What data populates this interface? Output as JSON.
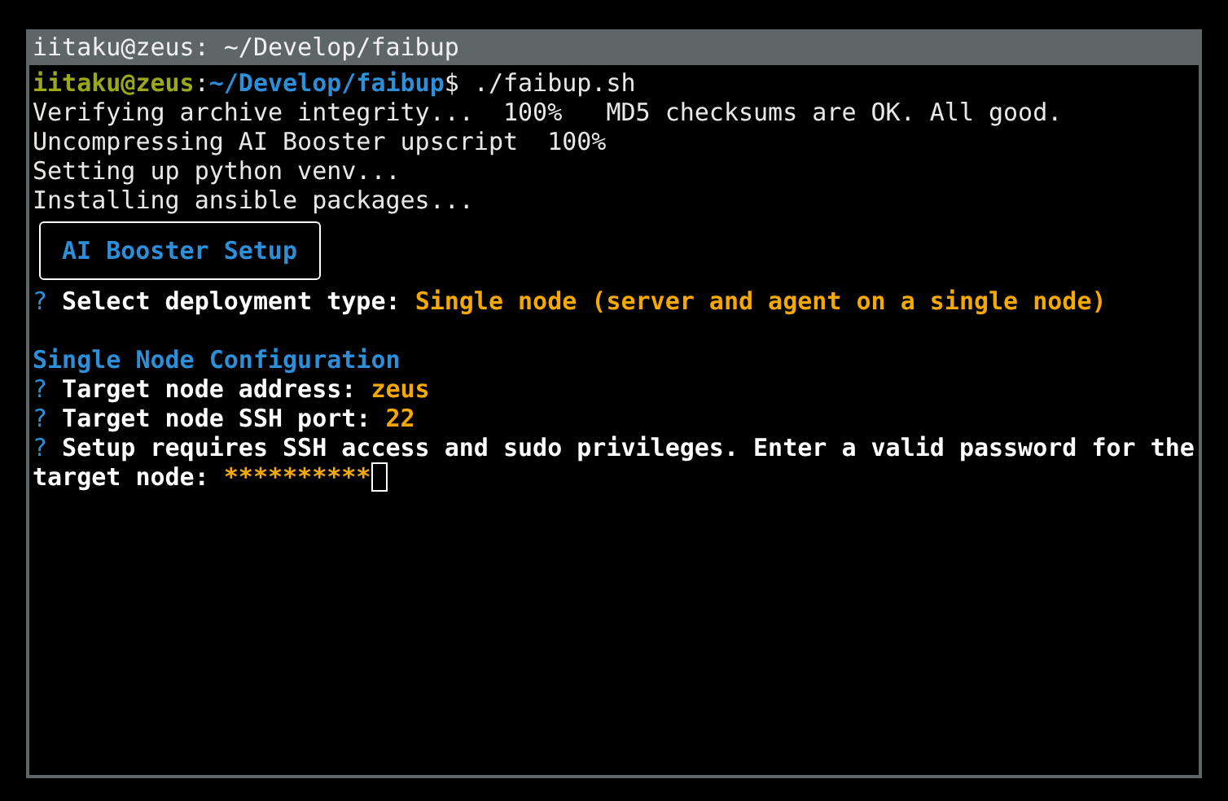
{
  "window": {
    "title": "iitaku@zeus: ~/Develop/faibup"
  },
  "terminal": {
    "lines": [
      {
        "kind": "text",
        "segments": [
          {
            "text": "iitaku@zeus",
            "kind": "user"
          },
          {
            "text": ":",
            "kind": "plain"
          },
          {
            "text": "~/Develop/faibup",
            "kind": "path"
          },
          {
            "text": "$ ./faibup.sh",
            "kind": "plain"
          }
        ]
      },
      {
        "kind": "text",
        "segments": [
          {
            "text": "Verifying archive integrity...  100%   MD5 checksums are OK. All good.",
            "kind": "plain"
          }
        ]
      },
      {
        "kind": "text",
        "segments": [
          {
            "text": "Uncompressing AI Booster upscript  100%",
            "kind": "plain"
          }
        ]
      },
      {
        "kind": "text",
        "segments": [
          {
            "text": "Setting up python venv...",
            "kind": "plain"
          }
        ]
      },
      {
        "kind": "text",
        "segments": [
          {
            "text": "Installing ansible packages...",
            "kind": "plain"
          }
        ]
      },
      {
        "kind": "banner",
        "text": "AI Booster Setup"
      },
      {
        "kind": "text",
        "segments": [
          {
            "text": "?",
            "kind": "question"
          },
          {
            "text": " Select deployment type: ",
            "kind": "label"
          },
          {
            "text": "Single node (server and agent on a single node)",
            "kind": "answer"
          }
        ]
      },
      {
        "kind": "blank"
      },
      {
        "kind": "text",
        "segments": [
          {
            "text": "Single Node Configuration",
            "kind": "heading"
          }
        ]
      },
      {
        "kind": "text",
        "segments": [
          {
            "text": "?",
            "kind": "question"
          },
          {
            "text": " Target node address: ",
            "kind": "label"
          },
          {
            "text": "zeus",
            "kind": "answer"
          }
        ]
      },
      {
        "kind": "text",
        "segments": [
          {
            "text": "?",
            "kind": "question"
          },
          {
            "text": " Target node SSH port: ",
            "kind": "label"
          },
          {
            "text": "22",
            "kind": "answer"
          }
        ]
      },
      {
        "kind": "text",
        "segments": [
          {
            "text": "?",
            "kind": "question"
          },
          {
            "text": " Setup requires SSH access and sudo privileges. Enter a valid password for the",
            "kind": "label"
          }
        ]
      },
      {
        "kind": "text",
        "cursor": true,
        "segments": [
          {
            "text": "target node: ",
            "kind": "label"
          },
          {
            "text": "**********",
            "kind": "answer"
          }
        ]
      }
    ]
  }
}
